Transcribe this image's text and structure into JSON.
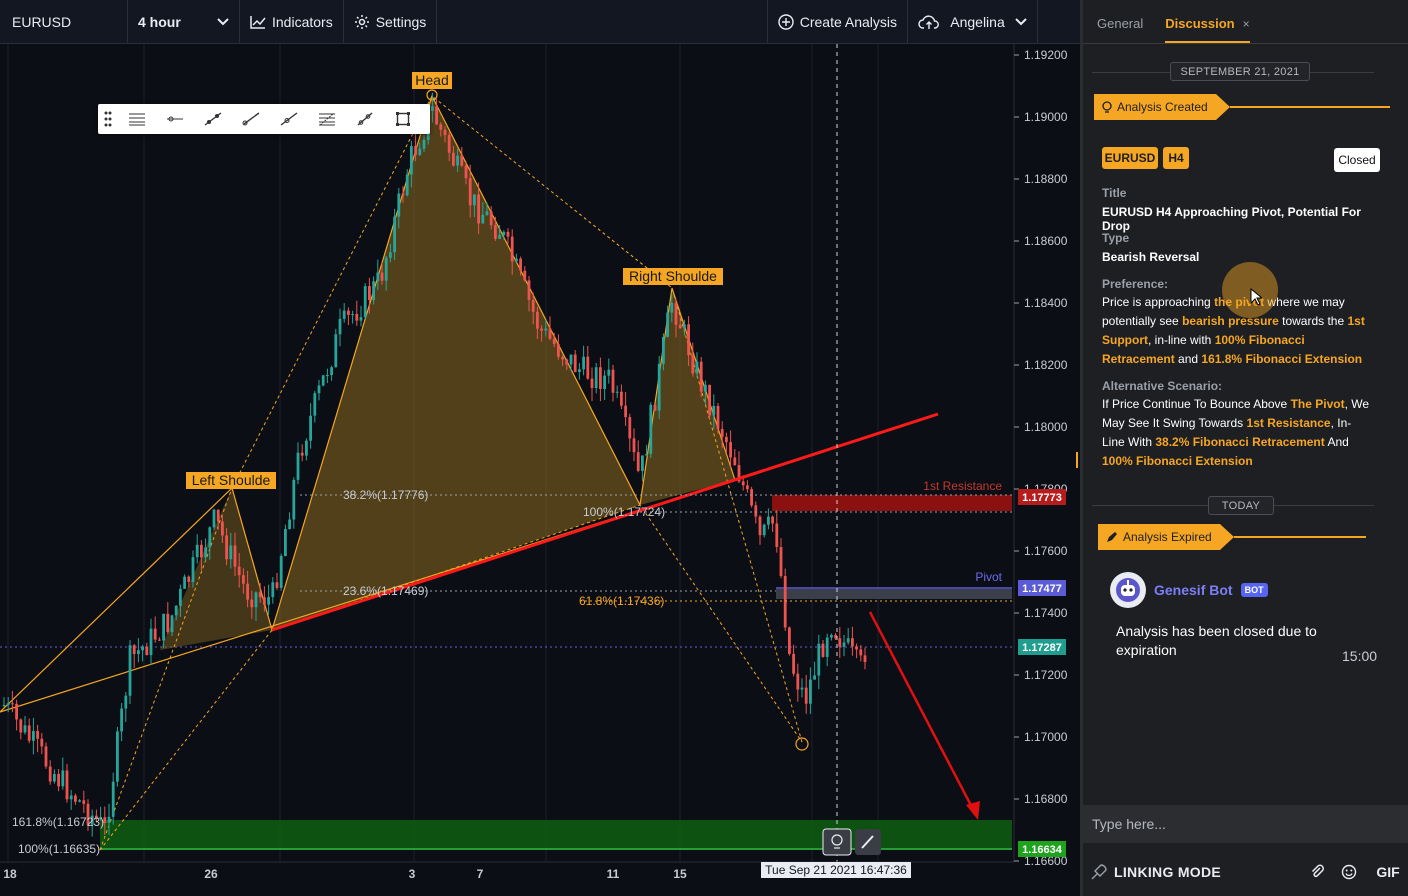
{
  "toolbar": {
    "symbol": "EURUSD",
    "interval": "4 hour",
    "indicators": "Indicators",
    "settings": "Settings",
    "create_analysis": "Create Analysis",
    "user": "Angelina"
  },
  "chart": {
    "price_axis": [
      "1.19200",
      "1.19000",
      "1.18800",
      "1.18600",
      "1.18400",
      "1.18200",
      "1.18000",
      "1.17800",
      "1.17600",
      "1.17400",
      "1.17200",
      "1.17000",
      "1.16800",
      "1.16600"
    ],
    "time_axis": [
      "18",
      "26",
      "3",
      "7",
      "11",
      "15"
    ],
    "crosshair_time": "Tue Sep 21 2021 16:47:36",
    "pattern_labels": {
      "left_shoulder": "Left Shoulde",
      "head": "Head",
      "right_shoulder": "Right Shoulde"
    },
    "fib_labels": {
      "f382": "38.2%(1.17776)",
      "f236": "23.6%(1.17469)",
      "f100a": "100%(1.17724)",
      "f618": "61.8%(1.17436)",
      "f1618": "161.8%(1.16723)",
      "f100b": "100%(1.16635)"
    },
    "zone_labels": {
      "resistance": "1st Resistance",
      "pivot": "Pivot"
    },
    "price_tags": {
      "resistance": "1.17773",
      "pivot": "1.17477",
      "current": "1.17287",
      "support": "1.16634"
    },
    "colors": {
      "bull": "#26a69a",
      "bear": "#ef5350",
      "pattern": "#f5a623",
      "trendline": "#ff1a1a",
      "resistance_zone": "#8b1010",
      "support_zone": "#0f6b12",
      "pivot": "#5b5bd6"
    }
  },
  "panel": {
    "tabs": [
      {
        "label": "General",
        "active": false
      },
      {
        "label": "Discussion",
        "active": true
      }
    ],
    "close_tab_icon": "×",
    "date_header": "SEPTEMBER 21, 2021",
    "created_banner": "Analysis Created",
    "tags": [
      "EURUSD",
      "H4"
    ],
    "status": "Closed",
    "title_label": "Title",
    "title": "EURUSD H4 Approaching Pivot, Potential For Drop",
    "type_label": "Type",
    "type": "Bearish Reversal",
    "preference_label": "Preference:",
    "preference": [
      {
        "t": "Price is approaching ",
        "h": false
      },
      {
        "t": "the pivot",
        "h": true
      },
      {
        "t": " where we may potentially see ",
        "h": false
      },
      {
        "t": "bearish pressure",
        "h": true
      },
      {
        "t": " towards the ",
        "h": false
      },
      {
        "t": "1st Support",
        "h": true
      },
      {
        "t": ", in-line with ",
        "h": false
      },
      {
        "t": "100% Fibonacci Retracement",
        "h": true
      },
      {
        "t": " and ",
        "h": false
      },
      {
        "t": "161.8% Fibonacci Extension",
        "h": true
      }
    ],
    "alternative_label": "Alternative Scenario:",
    "alternative": [
      {
        "t": "If Price Continue To Bounce Above ",
        "h": false
      },
      {
        "t": "The Pivot",
        "h": true
      },
      {
        "t": ", We May See It Swing Towards ",
        "h": false
      },
      {
        "t": "1st Resistance",
        "h": true
      },
      {
        "t": ", In-Line With ",
        "h": false
      },
      {
        "t": "38.2% Fibonacci Retracement",
        "h": true
      },
      {
        "t": " And ",
        "h": false
      },
      {
        "t": "100% Fibonacci Extension",
        "h": true
      }
    ],
    "today_header": "TODAY",
    "expired_banner": "Analysis Expired",
    "bot_name": "Genesif Bot",
    "bot_badge": "BOT",
    "bot_message": "Analysis has been closed due to expiration",
    "bot_time": "15:00",
    "input_placeholder": "Type here...",
    "linking_mode": "LINKING MODE",
    "gif_label": "GIF"
  }
}
